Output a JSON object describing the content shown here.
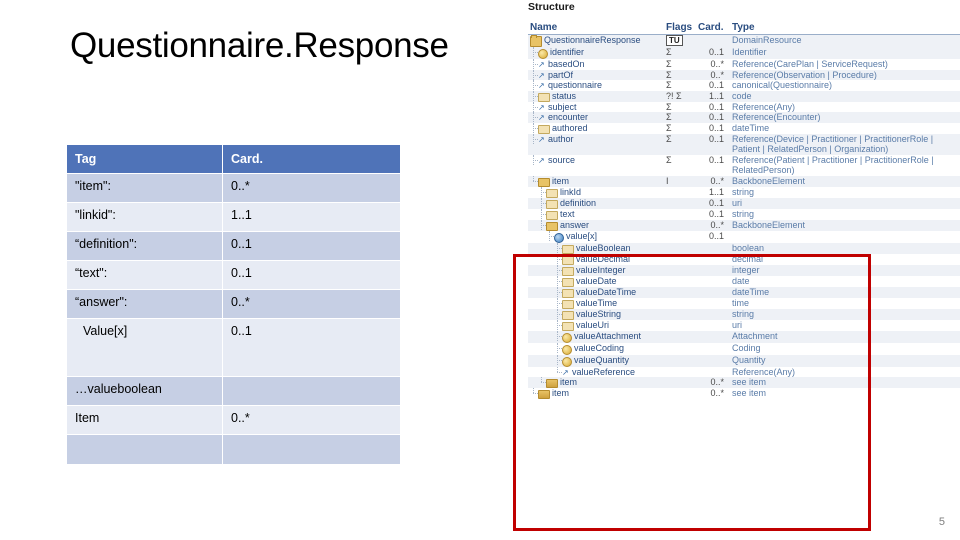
{
  "slide": {
    "title": "Questionnaire.Response",
    "number": "5"
  },
  "tag_table": {
    "headers": {
      "tag": "Tag",
      "card": "Card."
    },
    "rows": [
      {
        "tag": "\"item\":",
        "card": "0..*"
      },
      {
        "tag": "\"linkid\":",
        "card": "1..1"
      },
      {
        "tag": "“definition\":",
        "card": "0..1"
      },
      {
        "tag": "“text\":",
        "card": "0..1"
      },
      {
        "tag": "“answer\":",
        "card": "0..*"
      },
      {
        "tag": "Value[x]",
        "card": "0..1"
      },
      {
        "tag": "…valueboolean",
        "card": ""
      },
      {
        "tag": "Item",
        "card": "0..*"
      },
      {
        "tag": "",
        "card": ""
      }
    ]
  },
  "structure": {
    "heading": "Structure",
    "headers": {
      "name": "Name",
      "flags": "Flags",
      "card": "Card.",
      "type": "Type"
    },
    "rows": [
      {
        "name": "QuestionnaireResponse",
        "flags": "TU",
        "card": "",
        "type": "DomainResource"
      },
      {
        "name": "identifier",
        "flags": "Σ",
        "card": "0..1",
        "type": "Identifier"
      },
      {
        "name": "basedOn",
        "flags": "Σ",
        "card": "0..*",
        "type": "Reference(CarePlan | ServiceRequest)"
      },
      {
        "name": "partOf",
        "flags": "Σ",
        "card": "0..*",
        "type": "Reference(Observation | Procedure)"
      },
      {
        "name": "questionnaire",
        "flags": "Σ",
        "card": "0..1",
        "type": "canonical(Questionnaire)"
      },
      {
        "name": "status",
        "flags": "?! Σ",
        "card": "1..1",
        "type": "code"
      },
      {
        "name": "subject",
        "flags": "Σ",
        "card": "0..1",
        "type": "Reference(Any)"
      },
      {
        "name": "encounter",
        "flags": "Σ",
        "card": "0..1",
        "type": "Reference(Encounter)"
      },
      {
        "name": "authored",
        "flags": "Σ",
        "card": "0..1",
        "type": "dateTime"
      },
      {
        "name": "author",
        "flags": "Σ",
        "card": "0..1",
        "type": "Reference(Device | Practitioner | PractitionerRole | Patient | RelatedPerson | Organization)"
      },
      {
        "name": "source",
        "flags": "Σ",
        "card": "0..1",
        "type": "Reference(Patient | Practitioner | PractitionerRole | RelatedPerson)"
      },
      {
        "name": "item",
        "flags": "I",
        "card": "0..*",
        "type": "BackboneElement"
      },
      {
        "name": "linkId",
        "flags": "",
        "card": "1..1",
        "type": "string"
      },
      {
        "name": "definition",
        "flags": "",
        "card": "0..1",
        "type": "uri"
      },
      {
        "name": "text",
        "flags": "",
        "card": "0..1",
        "type": "string"
      },
      {
        "name": "answer",
        "flags": "",
        "card": "0..*",
        "type": "BackboneElement"
      },
      {
        "name": "value[x]",
        "flags": "",
        "card": "0..1",
        "type": ""
      },
      {
        "name": "valueBoolean",
        "flags": "",
        "card": "",
        "type": "boolean"
      },
      {
        "name": "valueDecimal",
        "flags": "",
        "card": "",
        "type": "decimal"
      },
      {
        "name": "valueInteger",
        "flags": "",
        "card": "",
        "type": "integer"
      },
      {
        "name": "valueDate",
        "flags": "",
        "card": "",
        "type": "date"
      },
      {
        "name": "valueDateTime",
        "flags": "",
        "card": "",
        "type": "dateTime"
      },
      {
        "name": "valueTime",
        "flags": "",
        "card": "",
        "type": "time"
      },
      {
        "name": "valueString",
        "flags": "",
        "card": "",
        "type": "string"
      },
      {
        "name": "valueUri",
        "flags": "",
        "card": "",
        "type": "uri"
      },
      {
        "name": "valueAttachment",
        "flags": "",
        "card": "",
        "type": "Attachment"
      },
      {
        "name": "valueCoding",
        "flags": "",
        "card": "",
        "type": "Coding"
      },
      {
        "name": "valueQuantity",
        "flags": "",
        "card": "",
        "type": "Quantity"
      },
      {
        "name": "valueReference",
        "flags": "",
        "card": "",
        "type": "Reference(Any)"
      },
      {
        "name": "item",
        "flags": "",
        "card": "0..*",
        "type": "see item"
      },
      {
        "name": "item",
        "flags": "",
        "card": "0..*",
        "type": "see item"
      }
    ]
  },
  "colors": {
    "table_header": "#4f73b8",
    "table_row_odd": "#c6cfe4",
    "table_row_even": "#e7ebf4",
    "highlight_box": "#c00000",
    "structure_text": "#2a4d80",
    "structure_type": "#5a7ca8"
  }
}
